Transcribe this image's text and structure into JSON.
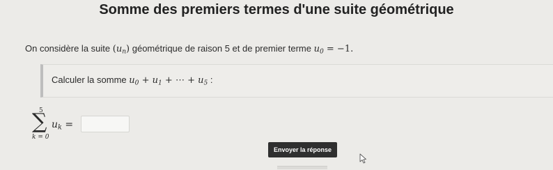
{
  "page": {
    "title": "Somme des premiers termes d'une suite géométrique"
  },
  "intro": {
    "text_before_seq": "On considère la suite ",
    "seq_open": "(",
    "seq_var": "u",
    "seq_sub": "n",
    "seq_close": ")",
    "text_after_seq": " géométrique de raison 5 et de premier terme ",
    "first_term_var": "u",
    "first_term_sub": "0",
    "first_term_rest": " = −1",
    "end": "."
  },
  "question": {
    "text": "Calculer la somme ",
    "sum_terms": [
      {
        "var": "u",
        "sub": "0"
      },
      {
        "var": "u",
        "sub": "1"
      },
      {
        "var": "u",
        "sub": "5"
      }
    ],
    "plus": " + ",
    "ellipsis": " + ⋯ + ",
    "colon": " :"
  },
  "answer": {
    "sigma_symbol": "∑",
    "upper_bound": "5",
    "lower_bound": "k = 0",
    "term_var": "u",
    "term_sub": "k",
    "equals": " =",
    "input_value": "",
    "input_placeholder": ""
  },
  "submit": {
    "label": "Envoyer la réponse"
  },
  "colors": {
    "background": "#ecebe8",
    "button_bg": "#2f2f2f",
    "button_text": "#ffffff",
    "box_border": "#bdbdbd"
  },
  "icons": {
    "cursor": "mouse-pointer-icon"
  }
}
